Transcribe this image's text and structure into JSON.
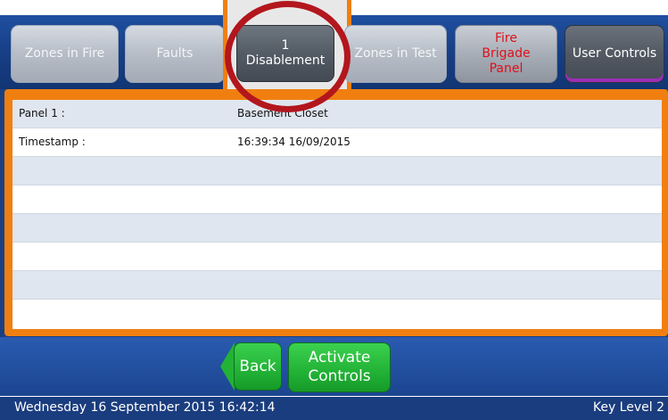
{
  "tabs": [
    {
      "label": "Zones in Fire"
    },
    {
      "label": "Faults"
    },
    {
      "count": "1",
      "label": "Disablement"
    },
    {
      "label": "Zones in Test"
    },
    {
      "line1": "Fire",
      "line2": "Brigade",
      "line3": "Panel"
    },
    {
      "label": "User Controls"
    }
  ],
  "details": {
    "rows": [
      {
        "label": "Panel 1 :",
        "value": "Basement Closet"
      },
      {
        "label": "Timestamp :",
        "value": "16:39:34 16/09/2015"
      }
    ]
  },
  "buttons": {
    "back": "Back",
    "activate_line1": "Activate",
    "activate_line2": "Controls"
  },
  "status": {
    "datetime": "Wednesday 16 September 2015 16:42:14",
    "key_level": "Key Level 2"
  },
  "colors": {
    "highlight_ring": "#b3161d",
    "frame_orange": "#f07f10",
    "navy": "#1c3f82",
    "button_green": "#22b236"
  }
}
